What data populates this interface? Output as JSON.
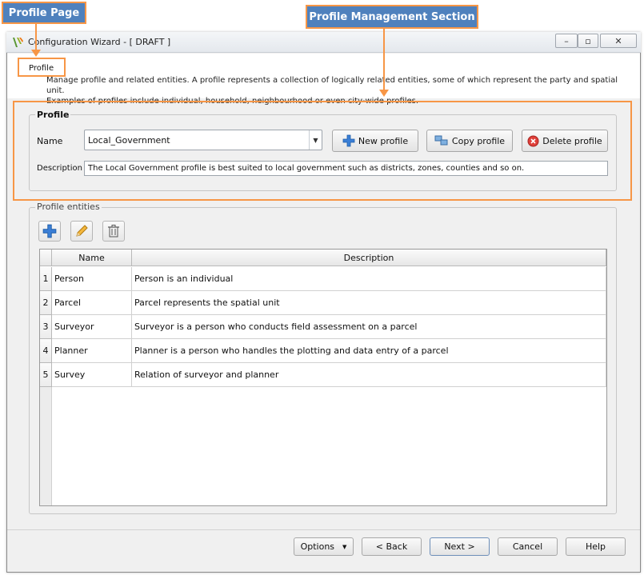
{
  "annotations": {
    "profile_page": "Profile Page",
    "profile_management_section": "Profile Management Section"
  },
  "window": {
    "title": "Configuration Wizard - [ DRAFT ]",
    "page_tab": "Profile",
    "description_line1": "Manage profile and related entities.  A profile represents a collection of logically related entities, some of which represent the party and spatial unit.",
    "description_line2": "Examples of profiles include individual, household, neighbourhood or even city-wide profiles."
  },
  "profile_group": {
    "title": "Profile",
    "name_label": "Name",
    "selected_profile": "Local_Government",
    "new_button": "New profile",
    "copy_button": "Copy profile",
    "delete_button": "Delete profile",
    "description_label": "Description",
    "description_value": "The Local Government profile is best suited to local government such as districts, zones, counties and so on."
  },
  "entities_group": {
    "title": "Profile entities",
    "columns": [
      "Name",
      "Description"
    ],
    "rows": [
      {
        "num": "1",
        "name": "Person",
        "description": "Person is an individual"
      },
      {
        "num": "2",
        "name": "Parcel",
        "description": "Parcel represents the spatial unit"
      },
      {
        "num": "3",
        "name": "Surveyor",
        "description": "Surveyor is a person who conducts field assessment on a parcel"
      },
      {
        "num": "4",
        "name": "Planner",
        "description": "Planner is a person who handles the plotting and data entry of a parcel"
      },
      {
        "num": "5",
        "name": "Survey",
        "description": "Relation of surveyor and planner"
      }
    ]
  },
  "footer": {
    "options": "Options",
    "back": "< Back",
    "next": "Next >",
    "cancel": "Cancel",
    "help": "Help"
  }
}
